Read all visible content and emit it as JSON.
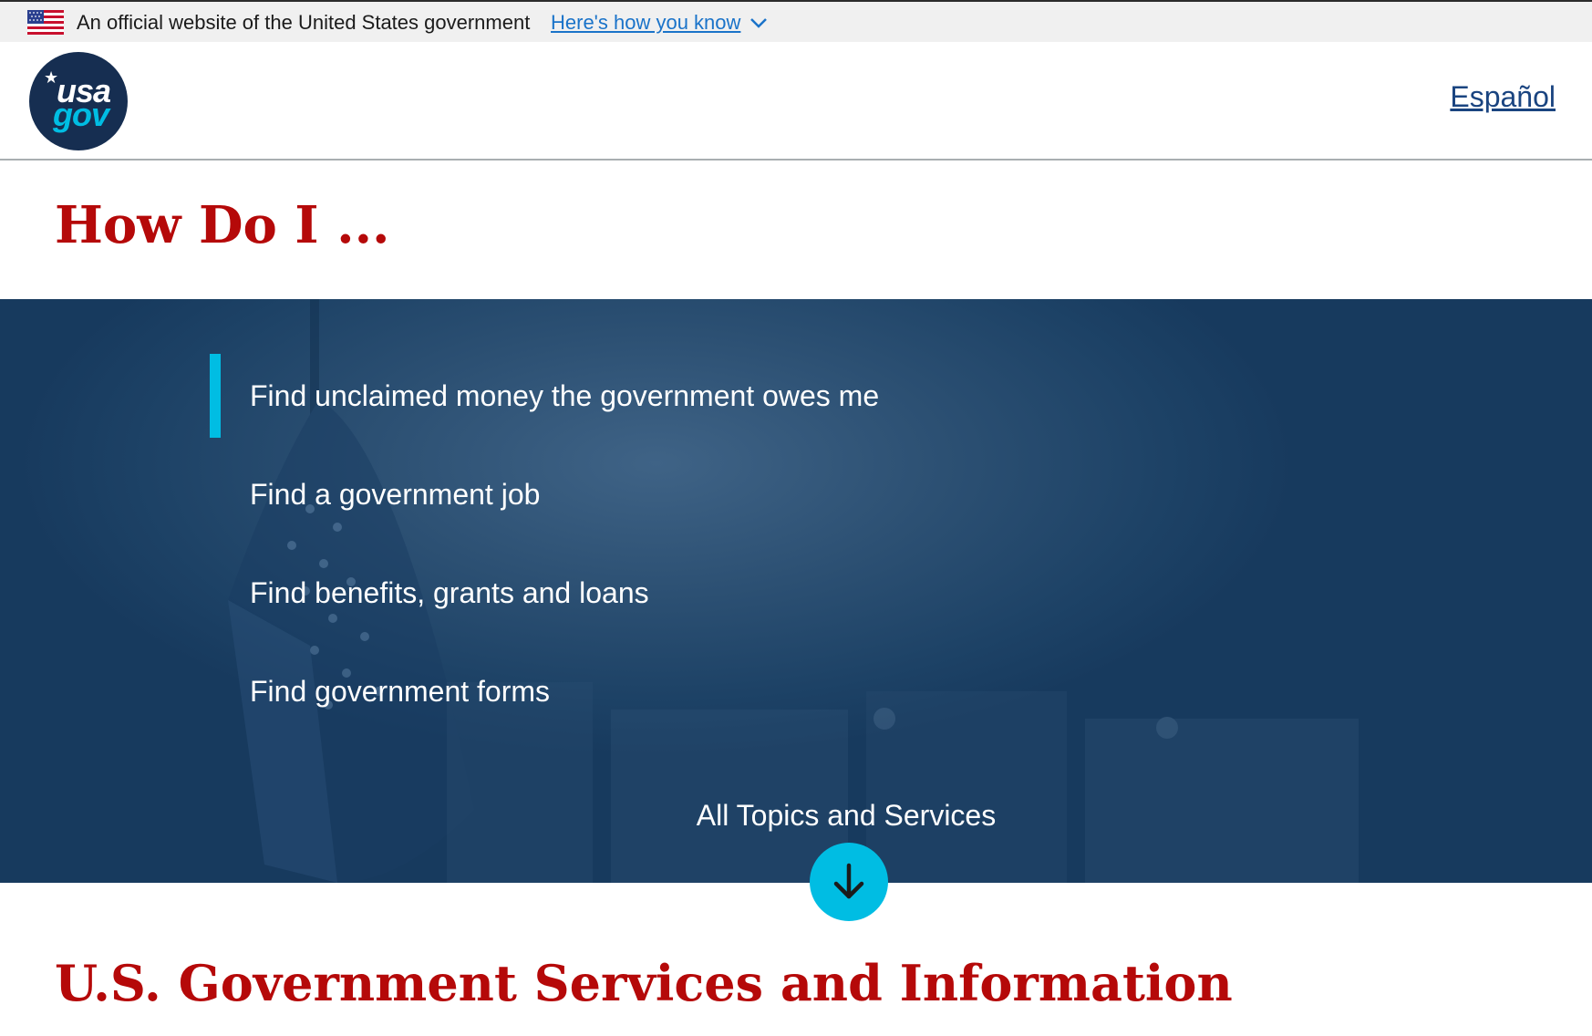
{
  "gov_banner": {
    "text": "An official website of the United States government",
    "link": "Here's how you know"
  },
  "header": {
    "logo_top": "usa",
    "logo_bottom": "gov",
    "language_link": "Español"
  },
  "how_do_i": {
    "title": "How Do I ...",
    "items": [
      {
        "label": "Find unclaimed money the government owes me",
        "active": true
      },
      {
        "label": "Find a government job"
      },
      {
        "label": "Find benefits, grants and loans"
      },
      {
        "label": "Find government forms"
      }
    ],
    "all_topics": "All Topics and Services"
  },
  "services_section": {
    "title": "U.S. Government Services and Information"
  },
  "colors": {
    "heading_red": "#b50909",
    "accent_cyan": "#00bde3",
    "navy": "#162e51",
    "link_blue": "#1a4480"
  },
  "icons": [
    "us-flag-icon",
    "chevron-down-icon",
    "usagov-logo",
    "arrow-down-icon"
  ]
}
